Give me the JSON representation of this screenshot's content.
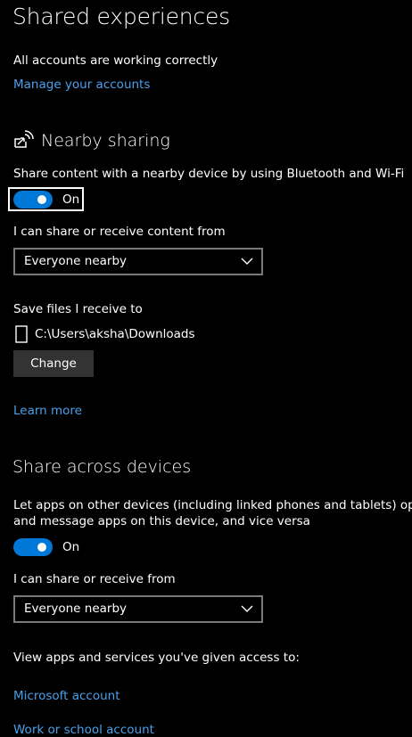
{
  "page": {
    "title": "Shared experiences"
  },
  "accounts": {
    "status": "All accounts are working correctly",
    "manage_link": "Manage your accounts"
  },
  "nearby_sharing": {
    "title": "Nearby sharing",
    "icon": "nearby-sharing-icon",
    "description": "Share content with a nearby device by using Bluetooth and Wi-Fi",
    "toggle": {
      "state": "On",
      "on": true
    },
    "share_from_label": "I can share or receive content from",
    "share_from_value": "Everyone nearby",
    "save_label": "Save files I receive to",
    "save_path": "C:\\Users\\aksha\\Downloads",
    "change_button": "Change",
    "learn_more": "Learn more"
  },
  "share_across": {
    "title": "Share across devices",
    "description_line1": "Let apps on other devices (including linked phones and tablets) open",
    "description_line2": "and message apps on this device, and vice versa",
    "toggle": {
      "state": "On",
      "on": true
    },
    "share_from_label": "I can share or receive from",
    "share_from_value": "Everyone nearby",
    "access_label": "View apps and services you've given access to:",
    "microsoft_account_link": "Microsoft account",
    "work_school_link": "Work or school account"
  },
  "colors": {
    "background": "#000000",
    "accent": "#0078d7",
    "link": "#4aa0ec",
    "button": "#333333"
  }
}
